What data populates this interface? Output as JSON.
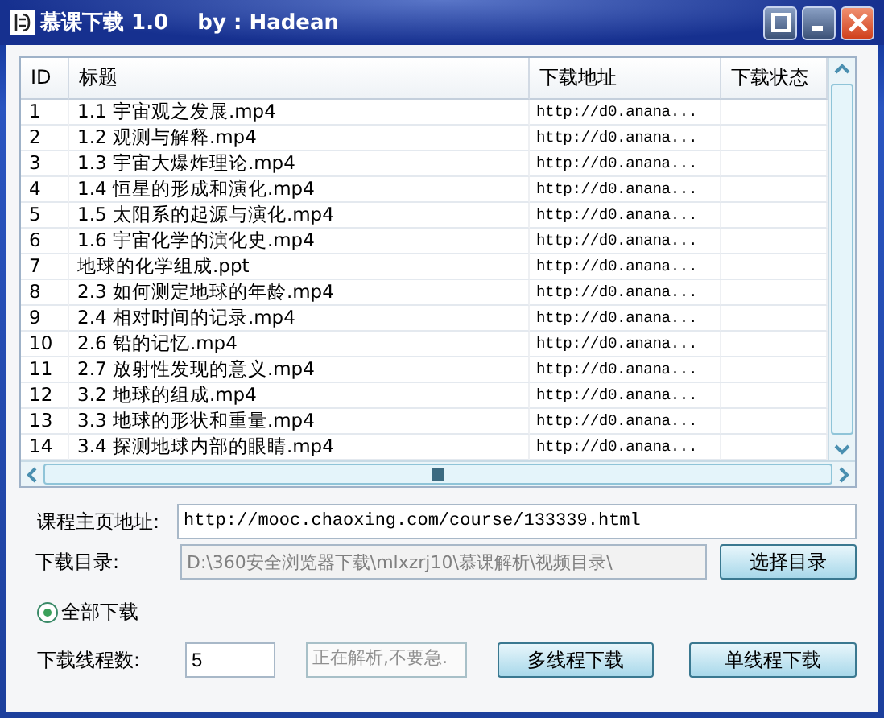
{
  "window": {
    "title": "慕课下载 1.0    by : Hadean"
  },
  "table": {
    "columns": [
      "ID",
      "标题",
      "下载地址",
      "下载状态"
    ],
    "rows": [
      [
        "1",
        "1.1 宇宙观之发展.mp4",
        "http://d0.anana...",
        ""
      ],
      [
        "2",
        "1.2 观测与解释.mp4",
        "http://d0.anana...",
        ""
      ],
      [
        "3",
        "1.3 宇宙大爆炸理论.mp4",
        "http://d0.anana...",
        ""
      ],
      [
        "4",
        "1.4 恒星的形成和演化.mp4",
        "http://d0.anana...",
        ""
      ],
      [
        "5",
        "1.5 太阳系的起源与演化.mp4",
        "http://d0.anana...",
        ""
      ],
      [
        "6",
        "1.6 宇宙化学的演化史.mp4",
        "http://d0.anana...",
        ""
      ],
      [
        "7",
        "地球的化学组成.ppt",
        "http://d0.anana...",
        ""
      ],
      [
        "8",
        "2.3 如何测定地球的年龄.mp4",
        "http://d0.anana...",
        ""
      ],
      [
        "9",
        "2.4 相对时间的记录.mp4",
        "http://d0.anana...",
        ""
      ],
      [
        "10",
        "2.6 铅的记忆.mp4",
        "http://d0.anana...",
        ""
      ],
      [
        "11",
        "2.7 放射性发现的意义.mp4",
        "http://d0.anana...",
        ""
      ],
      [
        "12",
        "3.2 地球的组成.mp4",
        "http://d0.anana...",
        ""
      ],
      [
        "13",
        "3.3 地球的形状和重量.mp4",
        "http://d0.anana...",
        ""
      ],
      [
        "14",
        "3.4 探测地球内部的眼睛.mp4",
        "http://d0.anana...",
        ""
      ]
    ]
  },
  "course_url": {
    "label": "课程主页地址:",
    "value": "http://mooc.chaoxing.com/course/133339.html"
  },
  "download_dir": {
    "label": "下载目录:",
    "value": "D:\\360安全浏览器下载\\mlxzrj10\\慕课解析\\视频目录\\",
    "disabled": true,
    "button": "选择目录"
  },
  "options": [
    {
      "label": "全部下载",
      "selected": true
    }
  ],
  "threads": {
    "label": "下载线程数:",
    "value": "5"
  },
  "status_text": "正在解析,不要急.",
  "buttons": [
    "多线程下载",
    "单线程下载"
  ]
}
